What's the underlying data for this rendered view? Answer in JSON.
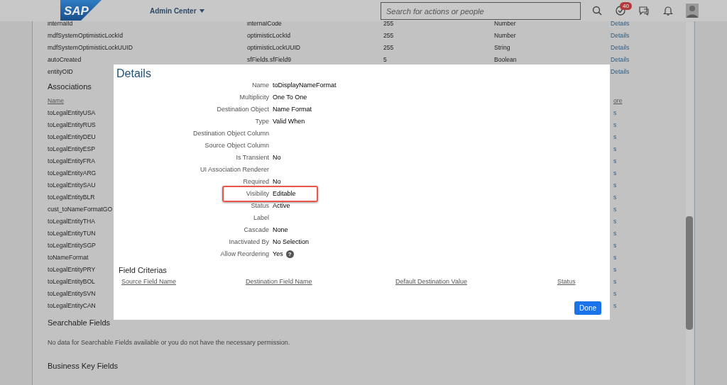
{
  "header": {
    "logo": "SAP",
    "menu": "Admin Center",
    "search": {
      "placeholder": "Search for actions or people"
    },
    "tasks_badge": "40"
  },
  "fields_table": {
    "rows": [
      [
        "internalId",
        "internalCode",
        "255",
        "Number",
        "Details"
      ],
      [
        "mdfSystemOptimisticLockId",
        "optimisticLockId",
        "255",
        "Number",
        "Details"
      ],
      [
        "mdfSystemOptimisticLockUUID",
        "optimisticLockUUID",
        "255",
        "String",
        "Details"
      ],
      [
        "autoCreated",
        "sfFields.sfField9",
        "5",
        "Boolean",
        "Details"
      ],
      [
        "entityOID",
        "",
        "",
        "",
        "Details"
      ]
    ]
  },
  "associations": {
    "title": "Associations",
    "columns": [
      "Name",
      "ore"
    ],
    "rows": [
      [
        "toLegalEntityUSA",
        "s"
      ],
      [
        "toLegalEntityRUS",
        "s"
      ],
      [
        "toLegalEntityDEU",
        "s"
      ],
      [
        "toLegalEntityESP",
        "s"
      ],
      [
        "toLegalEntityFRA",
        "s"
      ],
      [
        "toLegalEntityARG",
        "s"
      ],
      [
        "toLegalEntitySAU",
        "s"
      ],
      [
        "toLegalEntityBLR",
        "s"
      ],
      [
        "cust_toNameFormatGO",
        "s"
      ],
      [
        "toLegalEntityTHA",
        "s"
      ],
      [
        "toLegalEntityTUN",
        "s"
      ],
      [
        "toLegalEntitySGP",
        "s"
      ],
      [
        "toNameFormat",
        "s"
      ],
      [
        "toLegalEntityPRY",
        "s"
      ],
      [
        "toLegalEntityBOL",
        "s"
      ],
      [
        "toLegalEntitySVN",
        "s"
      ],
      [
        "toLegalEntityCAN",
        "s"
      ]
    ]
  },
  "searchable_fields": {
    "title": "Searchable Fields",
    "message": "No data for Searchable Fields available or you do not have the necessary permission."
  },
  "business_key_fields": {
    "title": "Business Key Fields"
  },
  "dialog": {
    "title": "Details",
    "properties": [
      {
        "label": "Name",
        "value": "toDisplayNameFormat",
        "highlighted": false
      },
      {
        "label": "Multiplicity",
        "value": "One To One",
        "highlighted": false
      },
      {
        "label": "Destination Object",
        "value": "Name Format",
        "highlighted": false
      },
      {
        "label": "Type",
        "value": "Valid When",
        "highlighted": false
      },
      {
        "label": "Destination Object Column",
        "highlighted": false
      },
      {
        "label": "Source Object Column",
        "highlighted": false
      },
      {
        "label": "Is Transient",
        "value": "No",
        "highlighted": false
      },
      {
        "label": "UI Association Renderer",
        "highlighted": false
      },
      {
        "label": "Required",
        "value": "No",
        "highlighted": false
      },
      {
        "label": "Visibility",
        "value": "Editable",
        "highlighted": true
      },
      {
        "label": "Status",
        "value": "Active",
        "highlighted": false
      },
      {
        "label": "Label",
        "highlighted": false
      },
      {
        "label": "Cascade",
        "value": "None",
        "highlighted": false
      },
      {
        "label": "Inactivated By",
        "value": "No Selection",
        "highlighted": false
      },
      {
        "label": "Allow Reordering",
        "value": "Yes",
        "help": "?",
        "highlighted": false
      }
    ],
    "field_criterias": {
      "title": "Field Criterias",
      "columns": [
        "Source Field Name",
        "Destination Field Name",
        "Default Destination Value",
        "Status"
      ]
    },
    "buttons": [
      "Done"
    ]
  }
}
